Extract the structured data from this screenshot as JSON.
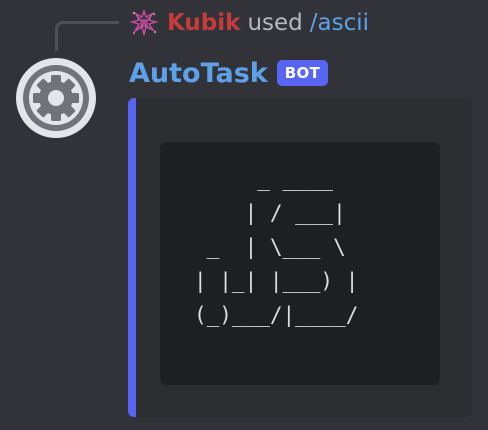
{
  "reply": {
    "username": "Kubik",
    "action": "used",
    "command": "/ascii"
  },
  "message": {
    "author": "AutoTask",
    "badge": "BOT",
    "avatar_icon": "gear-icon"
  },
  "embed": {
    "accent_color": "#5865f2",
    "code": "     _ ____\n    | / ___|\n _  | \\___ \\\n| |_| |___) |\n(_)___/|____/"
  },
  "colors": {
    "background": "#313338",
    "username_color": "#c63b3b",
    "link_color": "#5ea1e9"
  }
}
